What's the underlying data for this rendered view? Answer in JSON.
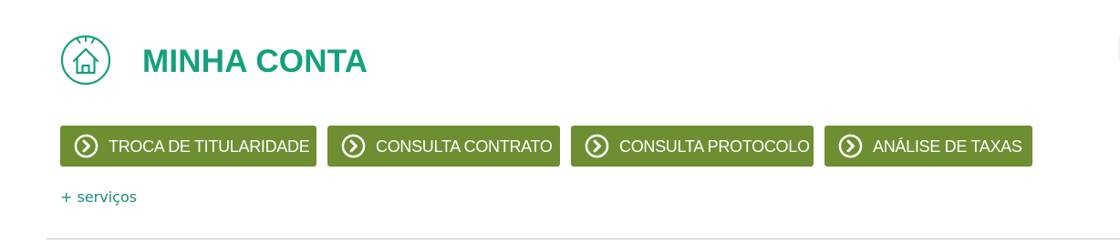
{
  "header": {
    "icon": "house-icon",
    "title": "MINHA CONTA"
  },
  "colors": {
    "accent_green": "#14a07e",
    "button_bg": "#6d8e31",
    "button_text": "#ffffff",
    "link": "#1c8d78"
  },
  "buttons": [
    {
      "icon": "chevron-right-circle-icon",
      "label": "TROCA DE TITULARIDADE"
    },
    {
      "icon": "chevron-right-circle-icon",
      "label": "CONSULTA CONTRATO"
    },
    {
      "icon": "chevron-right-circle-icon",
      "label": "CONSULTA PROTOCOLO"
    },
    {
      "icon": "chevron-right-circle-icon",
      "label": "ANÁLISE DE TAXAS"
    }
  ],
  "more_services": {
    "label": "+ serviços"
  }
}
